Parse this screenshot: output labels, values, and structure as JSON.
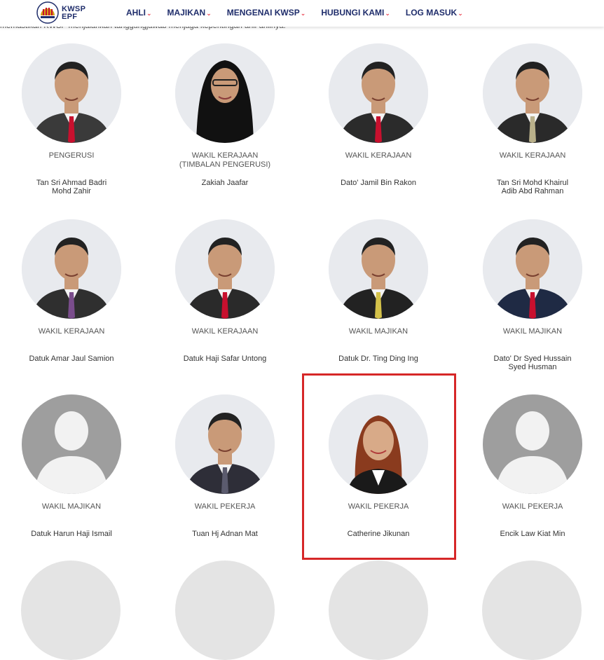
{
  "header": {
    "logo_text_1": "KWSP",
    "logo_text_2": "EPF",
    "nav": [
      {
        "label": "AHLI"
      },
      {
        "label": "MAJIKAN"
      },
      {
        "label": "MENGENAI KWSP"
      },
      {
        "label": "HUBUNGI KAMI"
      },
      {
        "label": "LOG MASUK"
      }
    ],
    "chevron": "⌄"
  },
  "intro_text": "memastikan KWSP menjalankan tanggungjawab menjaga kepentingan ahli-ahlinya.",
  "members": [
    {
      "role": "PENGERUSI",
      "name": "Tan Sri Ahmad Badri\nMohd Zahir",
      "photo": "person-photo",
      "tie": "#c8102e",
      "suit": "#3a3a3a"
    },
    {
      "role": "WAKIL KERAJAAN\n(TIMBALAN PENGERUSI)",
      "name": "Zakiah Jaafar",
      "photo": "person-photo-hijab",
      "tie": "#000000",
      "suit": "#1a1a1a"
    },
    {
      "role": "WAKIL KERAJAAN",
      "name": "Dato' Jamil Bin Rakon",
      "photo": "person-photo",
      "tie": "#c8102e",
      "suit": "#2b2b2b"
    },
    {
      "role": "WAKIL KERAJAAN",
      "name": "Tan Sri Mohd Khairul\nAdib Abd Rahman",
      "photo": "person-photo",
      "tie": "#b9b08a",
      "suit": "#2a2a2a"
    },
    {
      "role": "WAKIL KERAJAAN",
      "name": "Datuk Amar Jaul Samion",
      "photo": "person-photo",
      "tie": "#7a4d8c",
      "suit": "#2f2f2f"
    },
    {
      "role": "WAKIL KERAJAAN",
      "name": "Datuk Haji Safar Untong",
      "photo": "person-photo",
      "tie": "#c8102e",
      "suit": "#2a2a2a"
    },
    {
      "role": "WAKIL MAJIKAN",
      "name": "Datuk Dr. Ting Ding Ing",
      "photo": "person-photo",
      "tie": "#d4c24a",
      "suit": "#222222"
    },
    {
      "role": "WAKIL MAJIKAN",
      "name": "Dato' Dr Syed Hussain\nSyed Husman",
      "photo": "person-photo",
      "tie": "#c8102e",
      "suit": "#1f2a44"
    },
    {
      "role": "WAKIL MAJIKAN",
      "name": "Datuk Harun Haji Ismail",
      "photo": "placeholder-avatar",
      "tie": "",
      "suit": ""
    },
    {
      "role": "WAKIL PEKERJA",
      "name": "Tuan Hj Adnan Mat",
      "photo": "person-photo",
      "tie": "#5b5b6e",
      "suit": "#2e2e38"
    },
    {
      "role": "WAKIL PEKERJA",
      "name": "Catherine Jikunan",
      "photo": "person-photo-woman",
      "tie": "#ffffff",
      "suit": "#1a1a1a"
    },
    {
      "role": "WAKIL PEKERJA",
      "name": "Encik Law Kiat Min",
      "photo": "placeholder-avatar",
      "tie": "",
      "suit": ""
    }
  ],
  "colors": {
    "nav_text": "#1f2d6b",
    "nav_chevron": "#e8303f",
    "highlight_border": "#d62728",
    "placeholder_bg": "#9e9e9e"
  }
}
